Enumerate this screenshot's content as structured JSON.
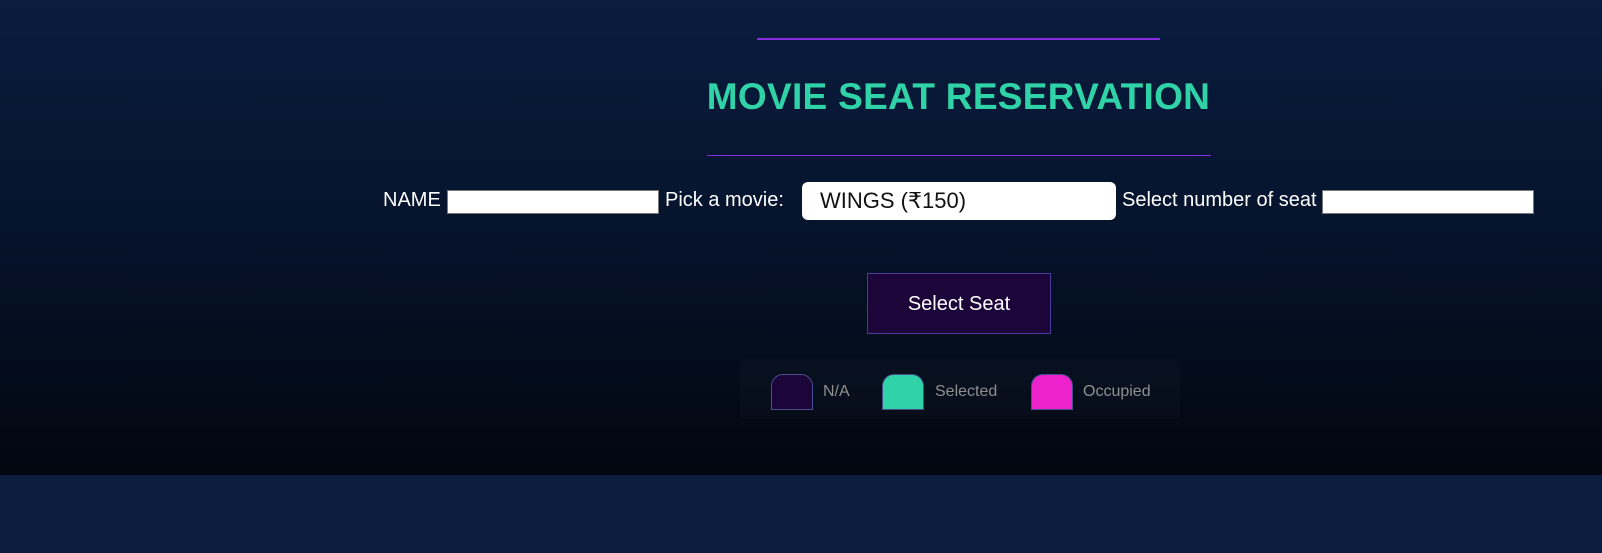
{
  "title": "MOVIE SEAT RESERVATION",
  "form": {
    "name_label": "NAME",
    "name_value": "",
    "movie_label": "Pick a movie:",
    "movie_selected": "WINGS (₹150)",
    "seat_count_label": "Select number of seat",
    "seat_count_value": ""
  },
  "button": {
    "select_seat_label": "Select Seat"
  },
  "legend": [
    {
      "label": "N/A",
      "color": "#1c0538"
    },
    {
      "label": "Selected",
      "color": "#2fd3a7"
    },
    {
      "label": "Occupied",
      "color": "#ee22cc"
    }
  ],
  "colors": {
    "accent": "#2fd3a7",
    "divider": "#8a2be2",
    "button_bg": "#1c0538"
  }
}
